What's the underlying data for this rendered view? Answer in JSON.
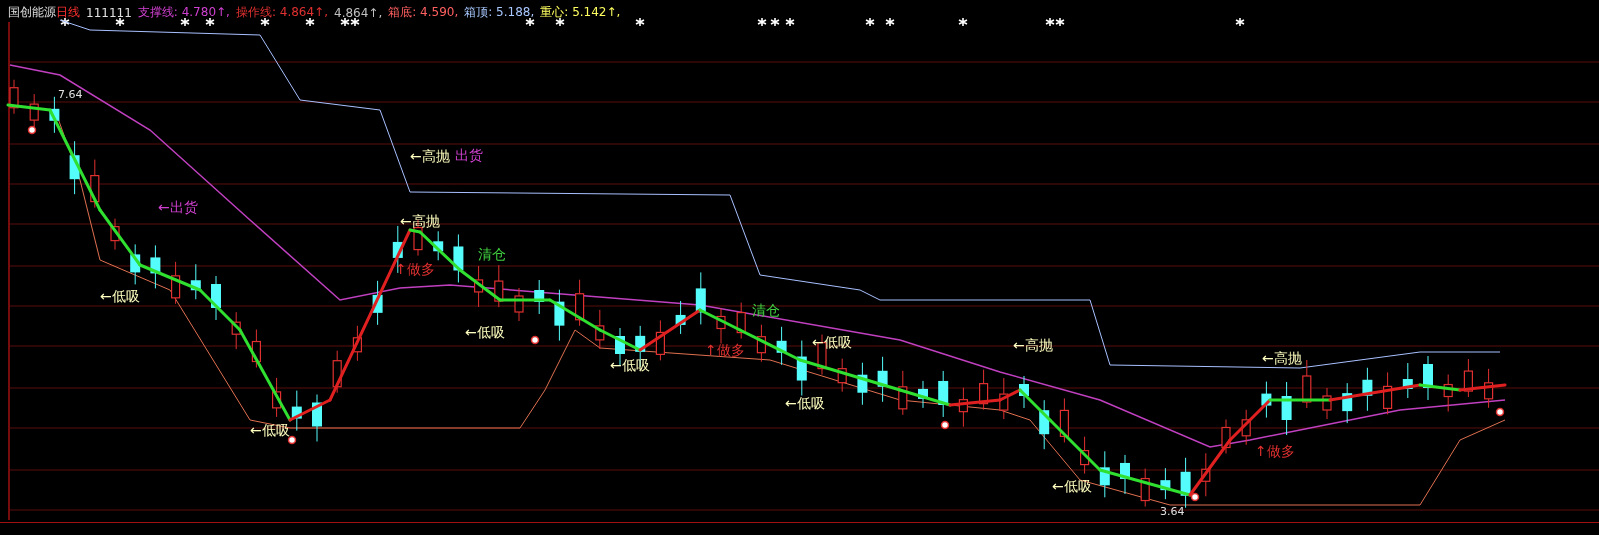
{
  "header": {
    "stock_name": "国创能源",
    "period": "日线",
    "code": "111111",
    "indicators": [
      {
        "text": "支撑线: 4.780↑,",
        "color": "#d040d0"
      },
      {
        "text": "操作线: 4.864↑,",
        "color": "#e03030"
      },
      {
        "text": "4.864↑,",
        "color": "#c0c0c0"
      },
      {
        "text": "箱底: 4.590,",
        "color": "#ff6060"
      },
      {
        "text": "箱顶: 5.188,",
        "color": "#a8c8ff"
      },
      {
        "text": "重心: 5.142↑,",
        "color": "#ffff60"
      }
    ]
  },
  "chart": {
    "annotations": [
      {
        "text": "7.64",
        "kind": "price"
      },
      {
        "text": "←出货",
        "kind": "exit"
      },
      {
        "text": "←低吸",
        "kind": "buy"
      },
      {
        "text": "←高抛",
        "kind": "sell"
      },
      {
        "text": "出货",
        "kind": "exit"
      },
      {
        "text": "←高抛",
        "kind": "sell"
      },
      {
        "text": "↑做多",
        "kind": "long"
      },
      {
        "text": "清仓",
        "kind": "clear"
      },
      {
        "text": "←低吸",
        "kind": "buy"
      },
      {
        "text": "←低吸",
        "kind": "buy"
      },
      {
        "text": "←低吸",
        "kind": "buy"
      },
      {
        "text": "↑做多",
        "kind": "long"
      },
      {
        "text": "清仓",
        "kind": "clear"
      },
      {
        "text": "←低吸",
        "kind": "buy"
      },
      {
        "text": "←低吸",
        "kind": "buy"
      },
      {
        "text": "←高抛",
        "kind": "sell"
      },
      {
        "text": "←低吸",
        "kind": "buy"
      },
      {
        "text": "3.64",
        "kind": "price"
      },
      {
        "text": "←高抛",
        "kind": "sell"
      },
      {
        "text": "↑做多",
        "kind": "long"
      }
    ]
  }
}
